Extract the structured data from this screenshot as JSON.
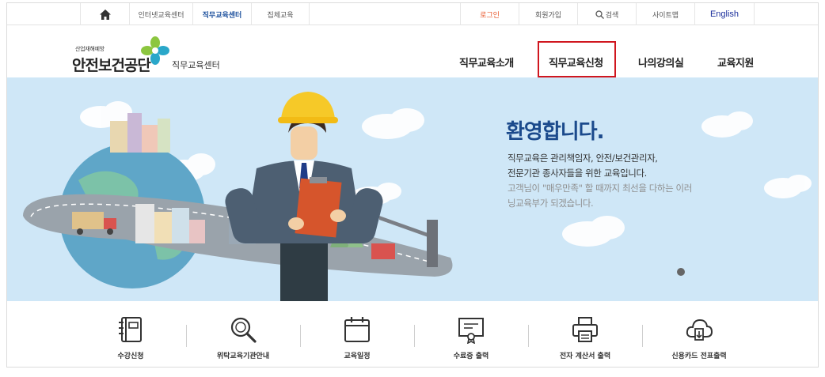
{
  "topbar": {
    "home_icon": "home-icon",
    "links": [
      "인터넷교육센터",
      "직무교육센터",
      "집체교육"
    ],
    "login": "로그인",
    "join": "회원가입",
    "search": "검색",
    "sitemap": "사이트맵",
    "english": "English"
  },
  "header": {
    "logo_small": "산업재해예방",
    "logo_main": "안전보건공단",
    "logo_sub": "직무교육센터",
    "nav": [
      "직무교육소개",
      "직무교육신청",
      "나의강의실",
      "교육지원"
    ]
  },
  "hero": {
    "title": "환영합니다.",
    "line1": "직무교육은 관리책임자, 안전/보건관리자,",
    "line2": "전문기관 종사자들을 위한 교육입니다.",
    "line3": "고객님이 \"매우만족\" 할 때까지 최선을 다하는 이러",
    "line4": "닝교육부가 되겠습니다."
  },
  "quick_menu": [
    {
      "label": "수강신청",
      "icon": "notebook-icon"
    },
    {
      "label": "위탁교육기관안내",
      "icon": "magnifier-icon"
    },
    {
      "label": "교육일정",
      "icon": "calendar-icon"
    },
    {
      "label": "수료증 출력",
      "icon": "certificate-icon"
    },
    {
      "label": "전자 계산서 출력",
      "icon": "printer-icon"
    },
    {
      "label": "신용카드 전표출력",
      "icon": "cloud-download-icon"
    }
  ],
  "colors": {
    "accent": "#1b4a8c",
    "highlight_box": "#d0161f",
    "hero_bg": "#cfe7f7",
    "login": "#e8562a"
  }
}
